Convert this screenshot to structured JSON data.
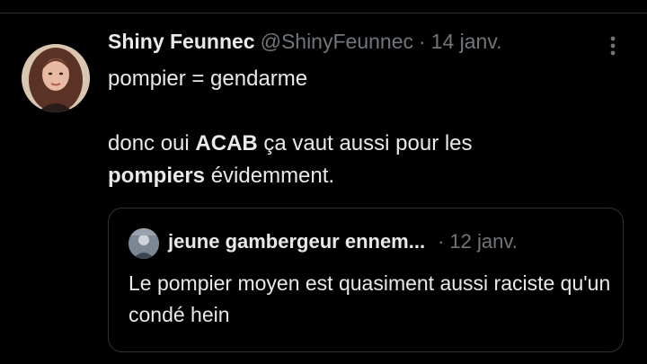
{
  "tweet": {
    "display_name": "Shiny Feunnec",
    "handle": "@ShinyFeunnec",
    "separator": "·",
    "date": "14 janv.",
    "more_icon": "more-vertical-icon",
    "lines": [
      "pompier = gendarme",
      "donc oui ",
      "ACAB",
      " ça vaut aussi pour les",
      "pompiers",
      " évidemment."
    ]
  },
  "quote": {
    "display_name": "jeune gambergeur ennem...",
    "separator": "·",
    "date": "12 janv.",
    "text": "Le pompier moyen est quasiment aussi raciste qu'un condé hein"
  },
  "colors": {
    "background": "#000000",
    "text": "#e7e9ea",
    "secondary": "#71767b",
    "border": "#2f3336"
  }
}
